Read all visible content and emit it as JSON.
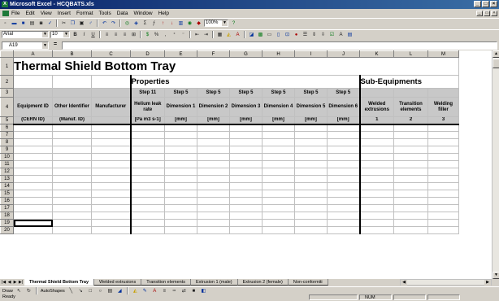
{
  "window": {
    "title": "Microsoft Excel - HCQBATS.xls",
    "controls": [
      "_",
      "□",
      "×"
    ]
  },
  "menu": {
    "items": [
      "File",
      "Edit",
      "View",
      "Insert",
      "Format",
      "Tools",
      "Data",
      "Window",
      "Help"
    ]
  },
  "toolbar": {
    "zoom": "100%",
    "font_name": "Arial",
    "font_size": "10"
  },
  "formula_bar": {
    "cell_ref": "A19",
    "equals": "=",
    "value": ""
  },
  "grid": {
    "columns": [
      "A",
      "B",
      "C",
      "D",
      "E",
      "F",
      "G",
      "H",
      "I",
      "J",
      "K",
      "L",
      "M"
    ],
    "rows": [
      "1",
      "2",
      "3",
      "4",
      "5",
      "6",
      "7",
      "8",
      "9",
      "10",
      "11",
      "12",
      "13",
      "14",
      "15",
      "16",
      "17",
      "18",
      "19",
      "20"
    ],
    "title": "Thermal Shield Bottom Tray",
    "section_properties": "Properties",
    "section_subequip": "Sub-Equipments",
    "steps": [
      "Step 11",
      "Step 5",
      "Step 5",
      "Step 5",
      "Step 5",
      "Step 5",
      "Step 5"
    ],
    "header_row4": {
      "A": "Equipment ID",
      "B": "Other Identifier",
      "C": "Manufacturer",
      "D": "Helium leak rate",
      "E": "Dimension 1",
      "F": "Dimension 2",
      "G": "Dimension 3",
      "H": "Dimension 4",
      "I": "Dimension 5",
      "J": "Dimension 6",
      "K": "Welded extrusions",
      "L": "Transition elements",
      "M": "Welding filler"
    },
    "header_row5": {
      "A": "(CERN ID)",
      "B": "(Manuf. ID)",
      "C": "",
      "D": "[Pa m3 s-1]",
      "E": "[mm]",
      "F": "[mm]",
      "G": "[mm]",
      "H": "[mm]",
      "I": "[mm]",
      "J": "[mm]",
      "K": "1",
      "L": "2",
      "M": "3"
    }
  },
  "sheets": {
    "tabs": [
      "Thermal Shield Bottom Tray",
      "Welded extrusions",
      "Transition elements",
      "Extrusion 1 (male)",
      "Extrusion 2 (female)",
      "Non-conformiti"
    ],
    "active": "Thermal Shield Bottom Tray"
  },
  "drawing_toolbar": {
    "draw_label": "Draw",
    "autoshapes_label": "AutoShapes"
  },
  "status": {
    "left": "Ready",
    "num": "NUM"
  }
}
